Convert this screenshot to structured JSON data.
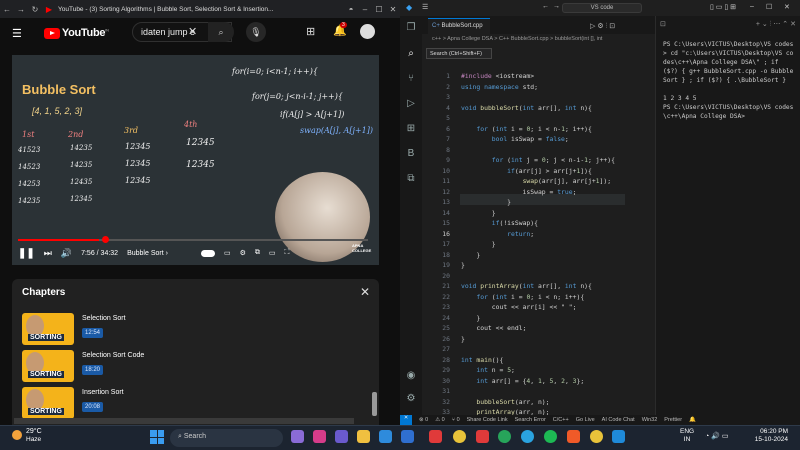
{
  "browser": {
    "tab_title": "YouTube - (3) Sorting Algorithms | Bubble Sort, Selection Sort & Insertion...",
    "search_value": "idaten jump e",
    "notification_count": "3"
  },
  "video": {
    "board_title": "Bubble Sort",
    "board_array": "[4, 1, 5, 2, 3]",
    "chalk_lines": [
      "for(i=0; i<n-1; i++){",
      "for(j=0; j<n-i-1; j++){",
      "if(A[j] > A[j+1])",
      "swap(A[j], A[j+1])"
    ],
    "chalk_col_labels": [
      "1st",
      "2nd",
      "3rd",
      "4th"
    ],
    "time": "7:56 / 34:32",
    "chapter_label": "Bubble Sort",
    "progress": 0.23,
    "webcam_badge": "APNA COLLEGE"
  },
  "chapters": {
    "title": "Chapters",
    "items": [
      {
        "name": "Selection Sort",
        "time": "12:54",
        "thumb_label": "SORTING"
      },
      {
        "name": "Selection Sort Code",
        "time": "18:20",
        "thumb_label": "SORTING"
      },
      {
        "name": "Insertion Sort",
        "time": "20:08",
        "thumb_label": "SORTING"
      }
    ]
  },
  "vscode": {
    "title": "VS code",
    "search_tooltip": "Search (Ctrl+Shift+F)",
    "tab": "BubbleSort.cpp",
    "breadcrumb": "c++ > Apna College DSA > C++ BubbleSort.cpp > bubbleSort(int [], int",
    "code": [
      {
        "n": "1",
        "t": "#include <iostream>"
      },
      {
        "n": "2",
        "t": "using namespace std;"
      },
      {
        "n": "3",
        "t": ""
      },
      {
        "n": "4",
        "t": "void bubbleSort(int arr[], int n){"
      },
      {
        "n": "5",
        "t": ""
      },
      {
        "n": "6",
        "t": "    for (int i = 0; i < n-1; i++){"
      },
      {
        "n": "7",
        "t": "        bool isSwap = false;"
      },
      {
        "n": "8",
        "t": ""
      },
      {
        "n": "9",
        "t": "        for (int j = 0; j < n-i-1; j++){"
      },
      {
        "n": "10",
        "t": "            if(arr[j] > arr[j+1]){"
      },
      {
        "n": "11",
        "t": "                swap(arr[j], arr[j+1]);"
      },
      {
        "n": "12",
        "t": "                isSwap = true;"
      },
      {
        "n": "13",
        "t": "            }"
      },
      {
        "n": "14",
        "t": "        }"
      },
      {
        "n": "15",
        "t": "        if(!isSwap){"
      },
      {
        "n": "16",
        "t": "            return;"
      },
      {
        "n": "17",
        "t": "        }"
      },
      {
        "n": "18",
        "t": "    }"
      },
      {
        "n": "19",
        "t": "}"
      },
      {
        "n": "20",
        "t": ""
      },
      {
        "n": "21",
        "t": "void printArray(int arr[], int n){"
      },
      {
        "n": "22",
        "t": "    for (int i = 0; i < n; i++){"
      },
      {
        "n": "23",
        "t": "        cout << arr[i] << \" \";"
      },
      {
        "n": "24",
        "t": "    }"
      },
      {
        "n": "25",
        "t": "    cout << endl;"
      },
      {
        "n": "26",
        "t": "}"
      },
      {
        "n": "27",
        "t": ""
      },
      {
        "n": "28",
        "t": "int main(){"
      },
      {
        "n": "29",
        "t": "    int n = 5;"
      },
      {
        "n": "30",
        "t": "    int arr[] = {4, 1, 5, 2, 3};"
      },
      {
        "n": "31",
        "t": ""
      },
      {
        "n": "32",
        "t": "    bubbleSort(arr, n);"
      },
      {
        "n": "33",
        "t": "    printArray(arr, n);"
      },
      {
        "n": "34",
        "t": "    return 0;"
      },
      {
        "n": "35",
        "t": "}"
      }
    ],
    "terminal": "PS C:\\Users\\VICTUS\\Desktop\\VS codes> cd \"c:\\Users\\VICTUS\\Desktop\\VS codes\\c++\\Apna College DSA\\\" ; if ($?) { g++ BubbleSort.cpp -o BubbleSort } ; if ($?) { .\\BubbleSort }\n\n1 2 3 4 5\nPS C:\\Users\\VICTUS\\Desktop\\VS codes\\c++\\Apna College DSA>",
    "status": {
      "errors": "0",
      "warnings": "0",
      "ports": "0",
      "share": "Share Code Link",
      "search_error": "Search Error",
      "lang": "C/C++",
      "golive": "Go Live",
      "ai": "AI Code Chat",
      "platform": "Win32",
      "prettier": "Prettier"
    }
  },
  "taskbar": {
    "temp": "29°C",
    "weather": "Haze",
    "search": "Search",
    "lang1": "ENG",
    "lang2": "IN",
    "time": "06:20 PM",
    "date": "15-10-2024"
  }
}
